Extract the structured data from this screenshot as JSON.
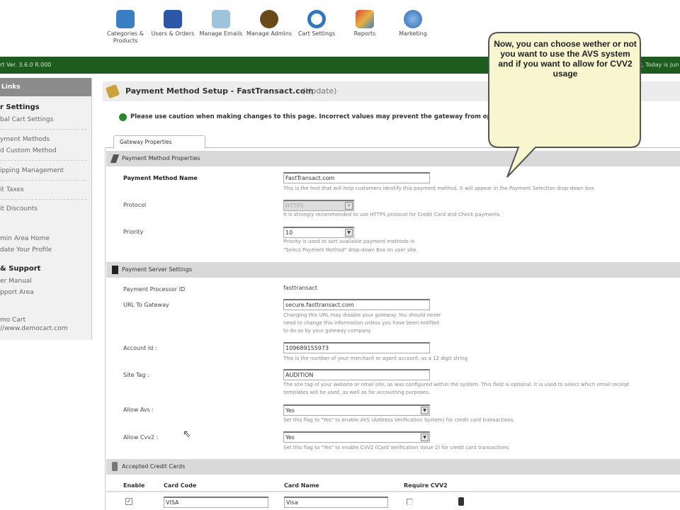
{
  "topnav": [
    {
      "label": "Categories & Products",
      "icon": "categories-icon",
      "color": "#3a7fc4"
    },
    {
      "label": "Users & Orders",
      "icon": "cart-icon",
      "color": "#2c56a8"
    },
    {
      "label": "Manage Emails",
      "icon": "envelope-icon",
      "color": "#9fc3dc"
    },
    {
      "label": "Manage Admins",
      "icon": "admins-icon",
      "color": "#6b4a1a"
    },
    {
      "label": "Cart Settings",
      "icon": "settings-icon",
      "color": "#2f78c0"
    },
    {
      "label": "Reports",
      "icon": "reports-icon",
      "color": "#d04a3a"
    },
    {
      "label": "Marketing",
      "icon": "globe-icon",
      "color": "#2a6bb5"
    }
  ],
  "header": {
    "version": "rt Ver. 3.6.0 R.000",
    "date": "t, Today is Jun"
  },
  "sidebar": {
    "title": "Links",
    "items": [
      "r Settings",
      "bal Cart Settings",
      "yment Methods",
      "d Custom Method",
      "ipping Management",
      "it Taxes",
      "it Discounts",
      "min Area Home",
      "date Your Profile",
      "& Support",
      "er Manual",
      "pport Area",
      "mo Cart",
      "//www.democart.com"
    ]
  },
  "page": {
    "title": "Payment Method Setup - FastTransact.com",
    "title_suffix": "(Update)",
    "caution": "Please use caution when making changes to this page. Incorrect values may prevent the gateway from oper",
    "tab": "Gateway Properties"
  },
  "props": {
    "section": "Payment Method Properties",
    "name_label": "Payment Method Name",
    "name_value": "FastTransact.com",
    "name_help": "This is the text that will help customers identify this payment method. It will appear in the Payment Selection drop-down box.",
    "protocol_label": "Protocol",
    "protocol_value": "HTTPS",
    "protocol_help": "It is strongly recommended to use HTTPS protocol for Credit Card and Check payments",
    "priority_label": "Priority",
    "priority_value": "10",
    "priority_help1": "Priority is used to sort available payment methods in",
    "priority_help2": "\"Select Payment Method\" drop-down Box on user site"
  },
  "server": {
    "section": "Payment Server Settings",
    "pid_label": "Payment Processor ID",
    "pid_value": "fasttransact",
    "url_label": "URL To Gateway",
    "url_value": "secure.fasttransact.com",
    "url_help1": "Changing this URL may disable your gateway. You should never",
    "url_help2": "need to change this information unless you have been notified",
    "url_help3": "to do so by your gateway company",
    "acct_label": "Account Id :",
    "acct_value": "109689155973",
    "acct_help": "This is the number of your merchant or agent account, as a 12 digit string",
    "tag_label": "Site Tag :",
    "tag_value": "AUDITION",
    "tag_help1": "The site tag of your website or retail site, as was configured within the system. This field is optional. It is used to select which email receipt",
    "tag_help2": "templates will be used, as well as for accounting purposes.",
    "avs_label": "Allow Avs :",
    "avs_value": "Yes",
    "avs_help": "Set this flag to \"Yes\" to enable AVS (Address Verification System) for credit card transactions",
    "cvv_label": "Allow Cvv2 :",
    "cvv_value": "Yes",
    "cvv_help": "Set this flag to \"Yes\" to enable CVV2 (Card Verification Value 2) for credit card transactions"
  },
  "cards": {
    "section": "Accepted Credit Cards",
    "headers": [
      "Enable",
      "Card Code",
      "Card Name",
      "Require CVV2"
    ],
    "rows": [
      {
        "enabled": true,
        "code": "VISA",
        "name": "Visa",
        "require_cvv2": false
      }
    ]
  },
  "callout": {
    "text": "Now, you can choose wether or not you want to use the AVS system and if you want to allow for CVV2 usage"
  }
}
